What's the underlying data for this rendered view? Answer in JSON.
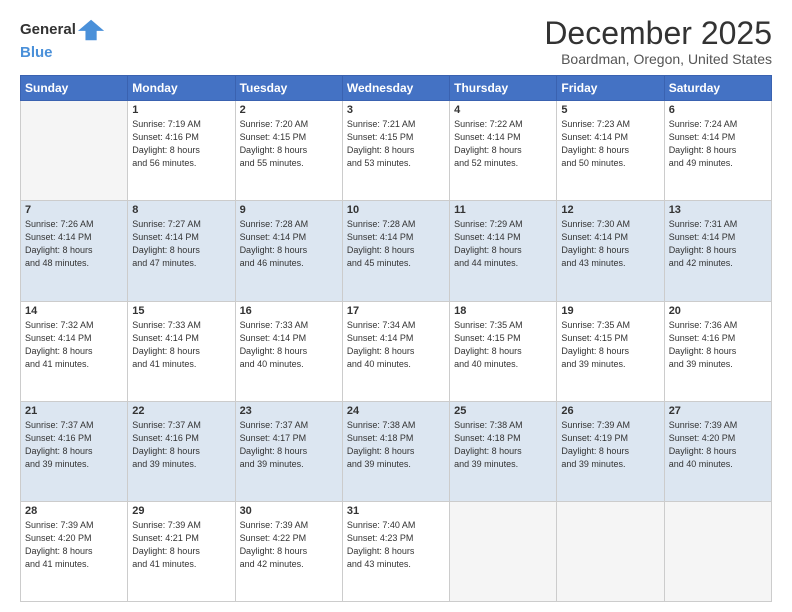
{
  "header": {
    "logo_line1": "General",
    "logo_line2": "Blue",
    "title": "December 2025",
    "subtitle": "Boardman, Oregon, United States"
  },
  "days_of_week": [
    "Sunday",
    "Monday",
    "Tuesday",
    "Wednesday",
    "Thursday",
    "Friday",
    "Saturday"
  ],
  "weeks": [
    [
      {
        "day": "",
        "sunrise": "",
        "sunset": "",
        "daylight": ""
      },
      {
        "day": "1",
        "sunrise": "7:19 AM",
        "sunset": "4:16 PM",
        "daylight": "8 hours and 56 minutes."
      },
      {
        "day": "2",
        "sunrise": "7:20 AM",
        "sunset": "4:15 PM",
        "daylight": "8 hours and 55 minutes."
      },
      {
        "day": "3",
        "sunrise": "7:21 AM",
        "sunset": "4:15 PM",
        "daylight": "8 hours and 53 minutes."
      },
      {
        "day": "4",
        "sunrise": "7:22 AM",
        "sunset": "4:14 PM",
        "daylight": "8 hours and 52 minutes."
      },
      {
        "day": "5",
        "sunrise": "7:23 AM",
        "sunset": "4:14 PM",
        "daylight": "8 hours and 50 minutes."
      },
      {
        "day": "6",
        "sunrise": "7:24 AM",
        "sunset": "4:14 PM",
        "daylight": "8 hours and 49 minutes."
      }
    ],
    [
      {
        "day": "7",
        "sunrise": "7:26 AM",
        "sunset": "4:14 PM",
        "daylight": "8 hours and 48 minutes."
      },
      {
        "day": "8",
        "sunrise": "7:27 AM",
        "sunset": "4:14 PM",
        "daylight": "8 hours and 47 minutes."
      },
      {
        "day": "9",
        "sunrise": "7:28 AM",
        "sunset": "4:14 PM",
        "daylight": "8 hours and 46 minutes."
      },
      {
        "day": "10",
        "sunrise": "7:28 AM",
        "sunset": "4:14 PM",
        "daylight": "8 hours and 45 minutes."
      },
      {
        "day": "11",
        "sunrise": "7:29 AM",
        "sunset": "4:14 PM",
        "daylight": "8 hours and 44 minutes."
      },
      {
        "day": "12",
        "sunrise": "7:30 AM",
        "sunset": "4:14 PM",
        "daylight": "8 hours and 43 minutes."
      },
      {
        "day": "13",
        "sunrise": "7:31 AM",
        "sunset": "4:14 PM",
        "daylight": "8 hours and 42 minutes."
      }
    ],
    [
      {
        "day": "14",
        "sunrise": "7:32 AM",
        "sunset": "4:14 PM",
        "daylight": "8 hours and 41 minutes."
      },
      {
        "day": "15",
        "sunrise": "7:33 AM",
        "sunset": "4:14 PM",
        "daylight": "8 hours and 41 minutes."
      },
      {
        "day": "16",
        "sunrise": "7:33 AM",
        "sunset": "4:14 PM",
        "daylight": "8 hours and 40 minutes."
      },
      {
        "day": "17",
        "sunrise": "7:34 AM",
        "sunset": "4:14 PM",
        "daylight": "8 hours and 40 minutes."
      },
      {
        "day": "18",
        "sunrise": "7:35 AM",
        "sunset": "4:15 PM",
        "daylight": "8 hours and 40 minutes."
      },
      {
        "day": "19",
        "sunrise": "7:35 AM",
        "sunset": "4:15 PM",
        "daylight": "8 hours and 39 minutes."
      },
      {
        "day": "20",
        "sunrise": "7:36 AM",
        "sunset": "4:16 PM",
        "daylight": "8 hours and 39 minutes."
      }
    ],
    [
      {
        "day": "21",
        "sunrise": "7:37 AM",
        "sunset": "4:16 PM",
        "daylight": "8 hours and 39 minutes."
      },
      {
        "day": "22",
        "sunrise": "7:37 AM",
        "sunset": "4:16 PM",
        "daylight": "8 hours and 39 minutes."
      },
      {
        "day": "23",
        "sunrise": "7:37 AM",
        "sunset": "4:17 PM",
        "daylight": "8 hours and 39 minutes."
      },
      {
        "day": "24",
        "sunrise": "7:38 AM",
        "sunset": "4:18 PM",
        "daylight": "8 hours and 39 minutes."
      },
      {
        "day": "25",
        "sunrise": "7:38 AM",
        "sunset": "4:18 PM",
        "daylight": "8 hours and 39 minutes."
      },
      {
        "day": "26",
        "sunrise": "7:39 AM",
        "sunset": "4:19 PM",
        "daylight": "8 hours and 39 minutes."
      },
      {
        "day": "27",
        "sunrise": "7:39 AM",
        "sunset": "4:20 PM",
        "daylight": "8 hours and 40 minutes."
      }
    ],
    [
      {
        "day": "28",
        "sunrise": "7:39 AM",
        "sunset": "4:20 PM",
        "daylight": "8 hours and 41 minutes."
      },
      {
        "day": "29",
        "sunrise": "7:39 AM",
        "sunset": "4:21 PM",
        "daylight": "8 hours and 41 minutes."
      },
      {
        "day": "30",
        "sunrise": "7:39 AM",
        "sunset": "4:22 PM",
        "daylight": "8 hours and 42 minutes."
      },
      {
        "day": "31",
        "sunrise": "7:40 AM",
        "sunset": "4:23 PM",
        "daylight": "8 hours and 43 minutes."
      },
      {
        "day": "",
        "sunrise": "",
        "sunset": "",
        "daylight": ""
      },
      {
        "day": "",
        "sunrise": "",
        "sunset": "",
        "daylight": ""
      },
      {
        "day": "",
        "sunrise": "",
        "sunset": "",
        "daylight": ""
      }
    ]
  ]
}
